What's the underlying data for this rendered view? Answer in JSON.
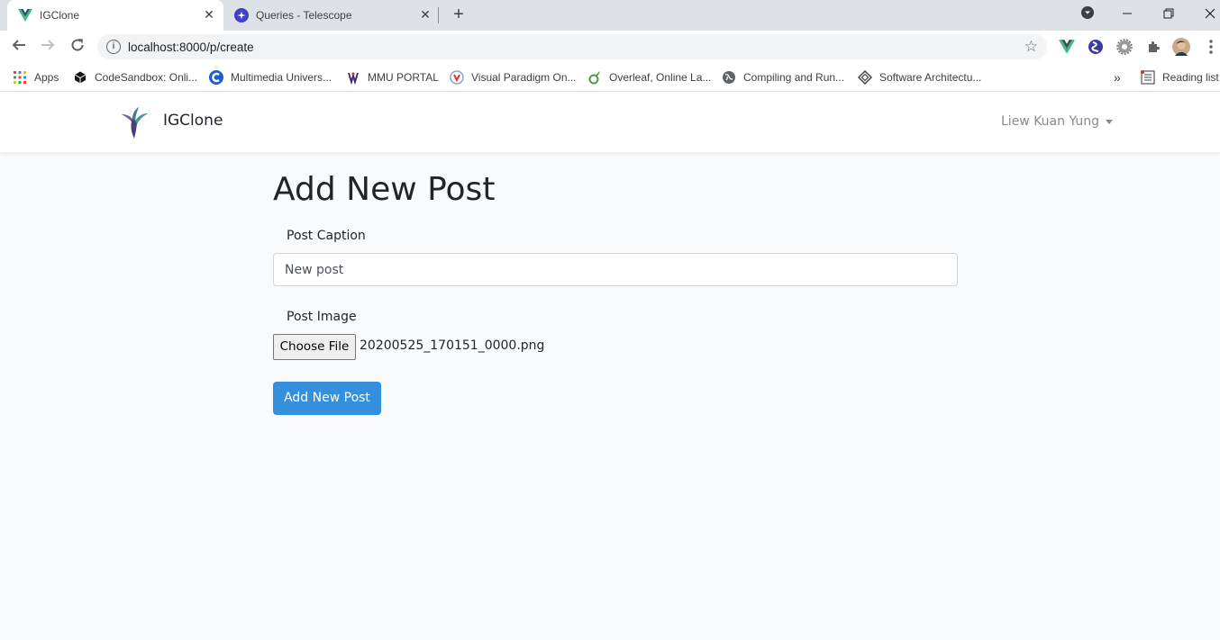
{
  "browser": {
    "tabs": [
      {
        "title": "IGClone",
        "active": true,
        "favicon": "vue-icon"
      },
      {
        "title": "Queries - Telescope",
        "active": false,
        "favicon": "telescope-icon"
      }
    ],
    "url": "localhost:8000/p/create",
    "bookmarks": [
      {
        "label": "Apps",
        "icon": "apps-grid-icon"
      },
      {
        "label": "CodeSandbox: Onli...",
        "icon": "codesandbox-icon"
      },
      {
        "label": "Multimedia Univers...",
        "icon": "mmu-c-icon"
      },
      {
        "label": "MMU PORTAL",
        "icon": "mmu-portal-icon"
      },
      {
        "label": "Visual Paradigm On...",
        "icon": "visual-paradigm-icon"
      },
      {
        "label": "Overleaf, Online La...",
        "icon": "overleaf-icon"
      },
      {
        "label": "Compiling and Run...",
        "icon": "globe-icon"
      },
      {
        "label": "Software Architectu...",
        "icon": "diamond-icon"
      }
    ],
    "bookmarks_overflow": "»",
    "reading_list": "Reading list"
  },
  "app": {
    "brand": "IGClone",
    "user_name": "Liew Kuan Yung"
  },
  "form": {
    "title": "Add New Post",
    "caption_label": "Post Caption",
    "caption_value": "New post",
    "image_label": "Post Image",
    "choose_file_label": "Choose File",
    "file_name": "20200525_170151_0000.png",
    "submit_label": "Add New Post"
  },
  "colors": {
    "primary": "#3490dc",
    "page_bg": "#f8fafc",
    "navbar_bg": "#ffffff",
    "muted_text": "#8a8a8a"
  }
}
